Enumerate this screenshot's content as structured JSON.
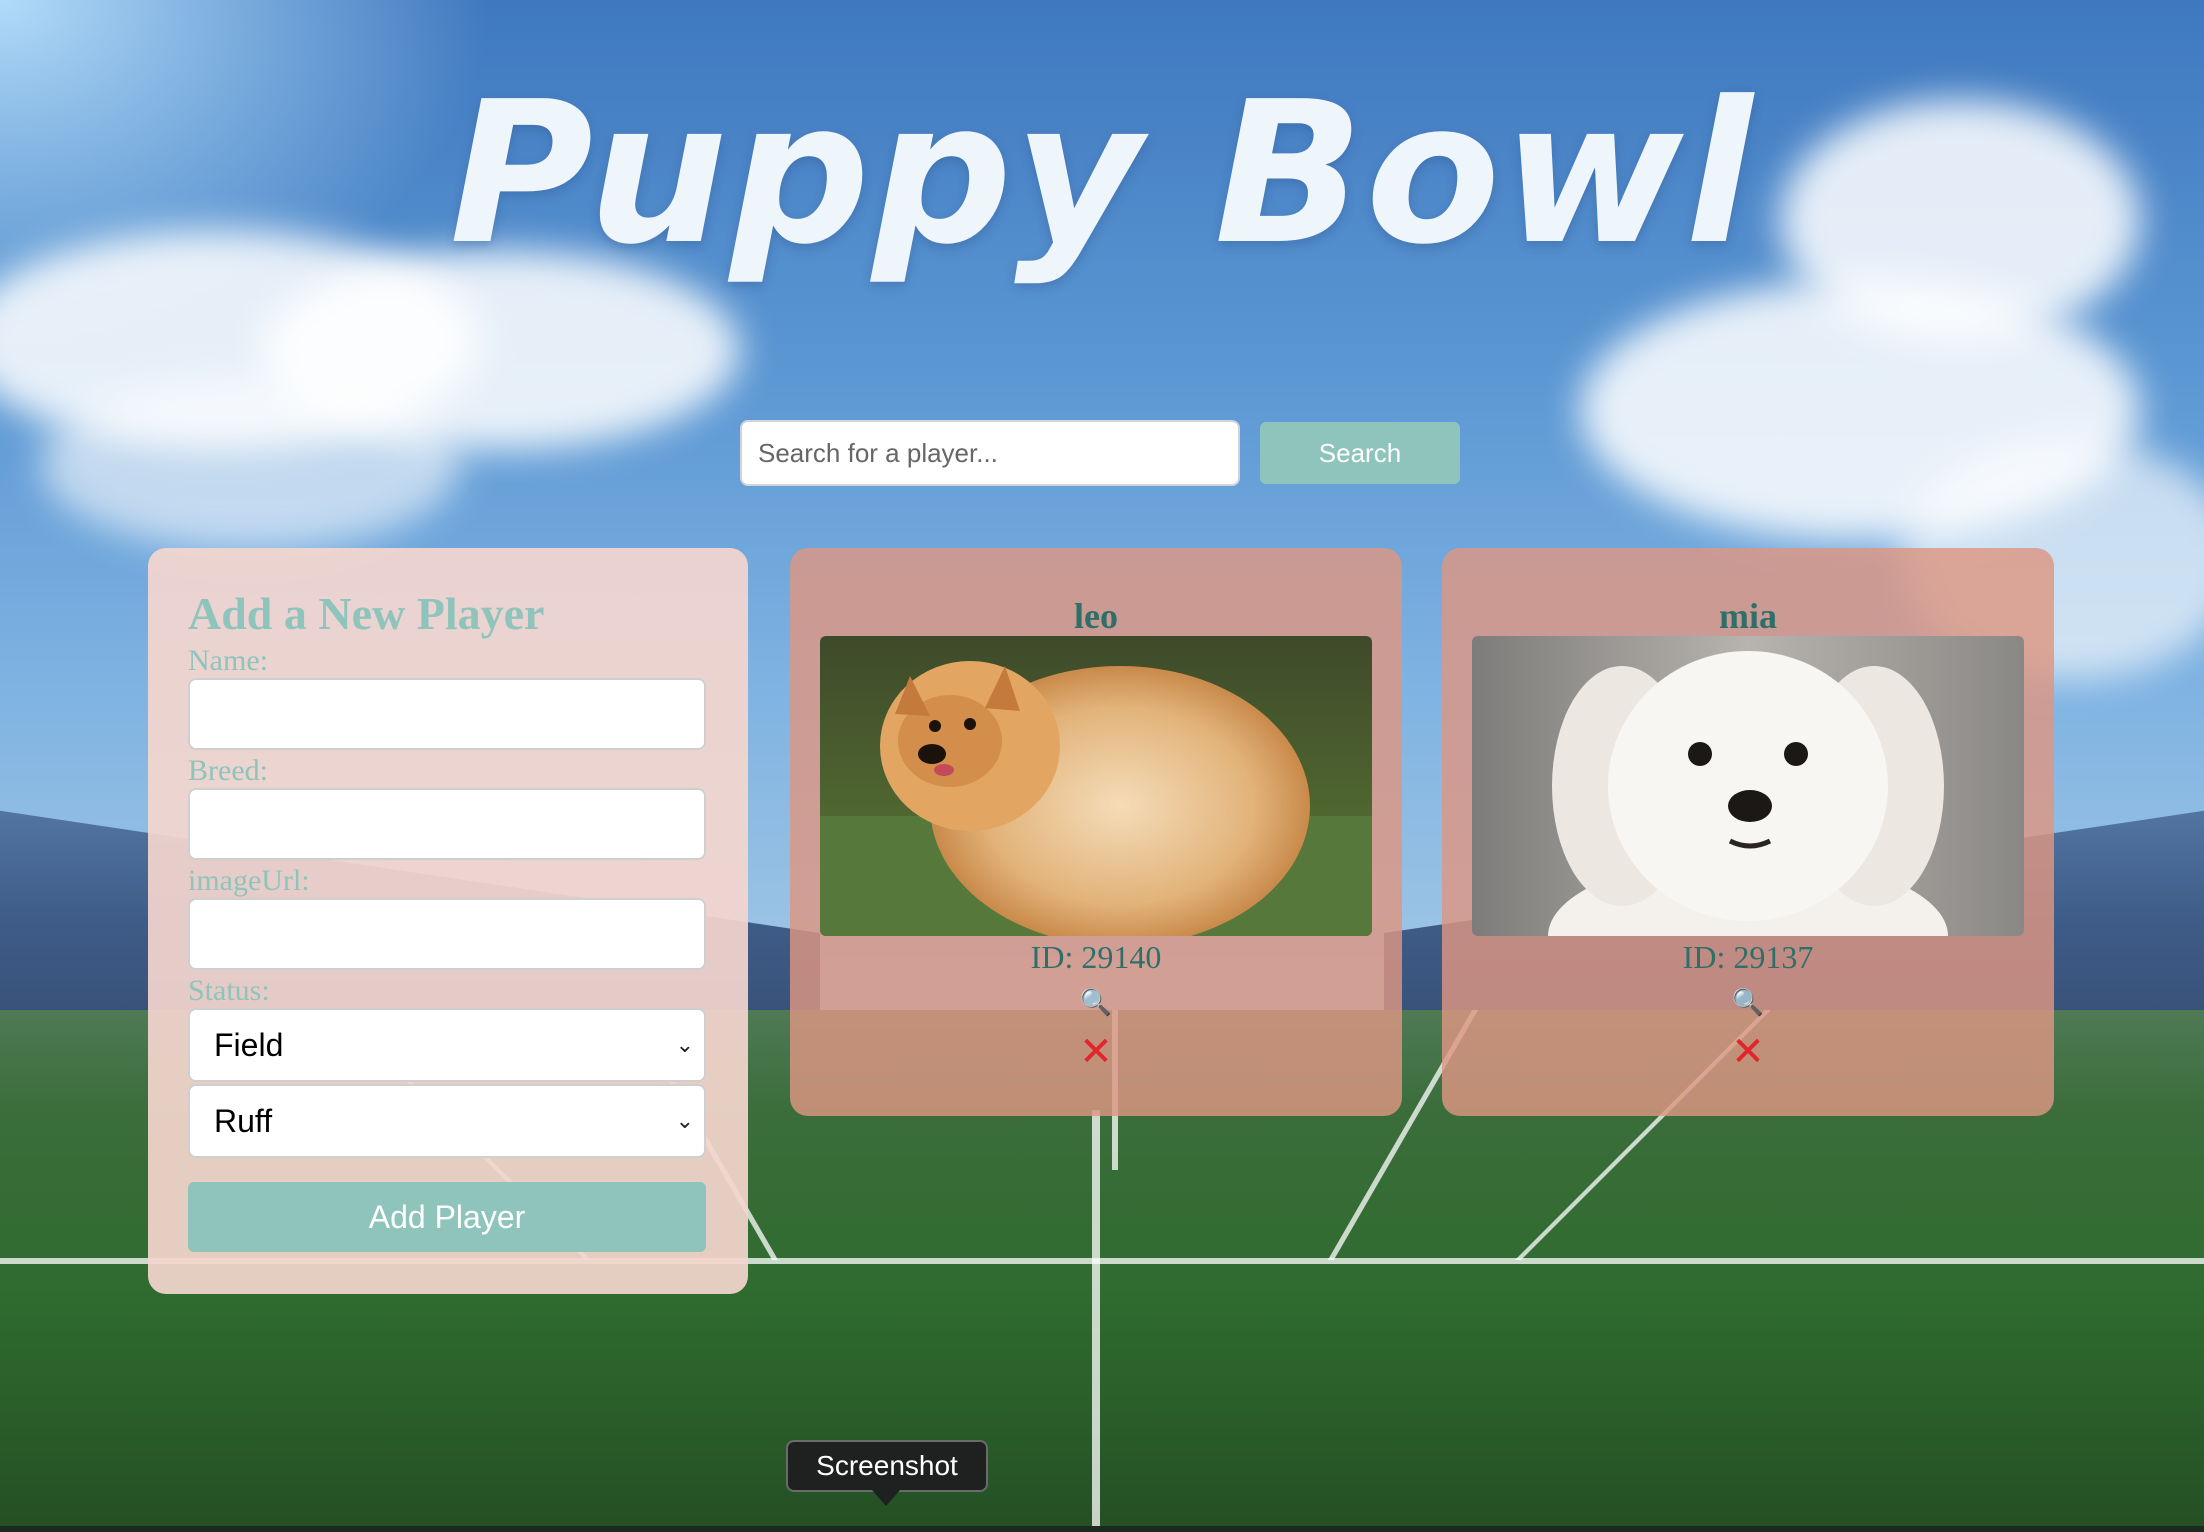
{
  "header": {
    "title": "Puppy Bowl"
  },
  "search": {
    "placeholder": "Search for a player...",
    "button_label": "Search"
  },
  "add_form": {
    "title": "Add a New Player",
    "name_label": "Name:",
    "breed_label": "Breed:",
    "image_label": "imageUrl:",
    "status_label": "Status:",
    "status_value": "Field",
    "team_value": "Ruff",
    "submit_label": "Add Player"
  },
  "players": [
    {
      "name": "leo",
      "id_text": "ID: 29140",
      "details_icon": "magnifier-icon",
      "delete_icon": "close-icon"
    },
    {
      "name": "mia",
      "id_text": "ID: 29137",
      "details_icon": "magnifier-icon",
      "delete_icon": "close-icon"
    }
  ],
  "tooltip": {
    "text": "Screenshot"
  },
  "colors": {
    "accent": "#8fc4bc",
    "card": "#dd9682",
    "form_card": "#f4d6ce",
    "delete": "#e0262a",
    "text_teal": "#2f6f6a"
  }
}
